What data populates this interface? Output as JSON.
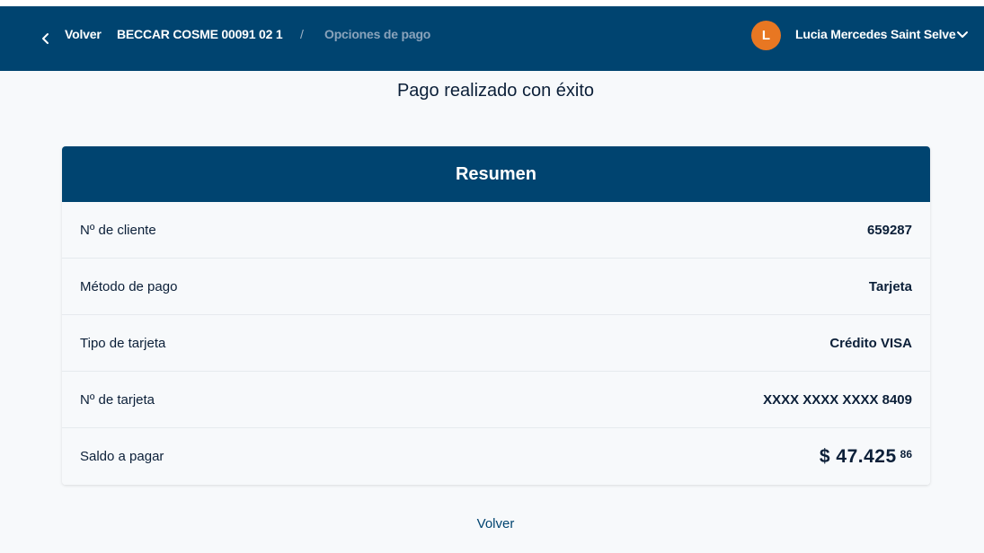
{
  "header": {
    "back_label": "Volver",
    "breadcrumb_account": "BECCAR COSME 00091 02 1",
    "breadcrumb_separator": "/",
    "breadcrumb_current": "Opciones de pago",
    "user_initial": "L",
    "user_name": "Lucia Mercedes Saint Selve",
    "avatar_color": "#e87722",
    "header_color": "#004470"
  },
  "page_title": "Pago realizado con éxito",
  "summary": {
    "title": "Resumen",
    "rows": [
      {
        "label": "Nº de cliente",
        "value": "659287"
      },
      {
        "label": "Método de pago",
        "value": "Tarjeta"
      },
      {
        "label": "Tipo de tarjeta",
        "value": "Crédito VISA"
      },
      {
        "label": "Nº de tarjeta",
        "value": "XXXX XXXX XXXX 8409"
      }
    ],
    "balance_label": "Saldo a pagar",
    "balance_amount": "$ 47.425",
    "balance_cents": "86"
  },
  "footer": {
    "back_link": "Volver"
  }
}
